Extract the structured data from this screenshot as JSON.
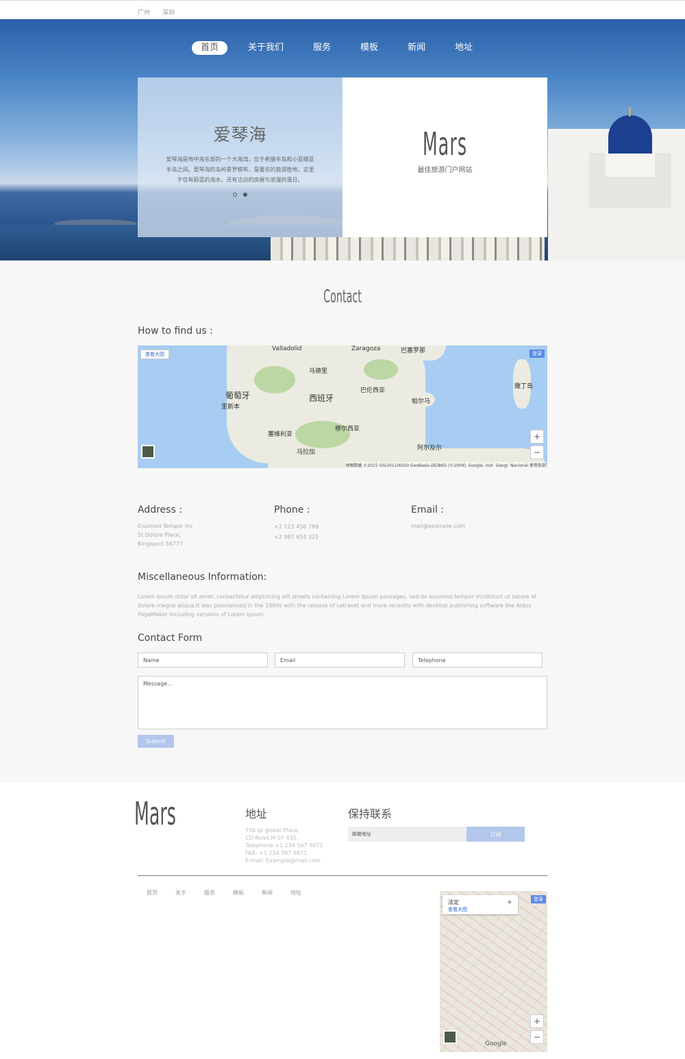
{
  "topbar": {
    "links": [
      "广州",
      "深圳"
    ]
  },
  "nav": {
    "items": [
      "首页",
      "关于我们",
      "服务",
      "模板",
      "新闻",
      "地址"
    ],
    "active": 0
  },
  "hero": {
    "title": "爱琴海",
    "description": "爱琴海是地中海东部的一个大海湾，位于希腊半岛和小亚细亚半岛之间。爱琴海的岛屿星罗棋布，是著名的旅游胜地，这里不仅有蔚蓝的海水，还有洁白的房屋与浪漫的落日。",
    "brand": "Mars",
    "brand_sub": "最佳旅游门户网站",
    "dots": 2,
    "active_dot": 1
  },
  "contact": {
    "section_title": "Contact",
    "find_label": "How to find us :",
    "map": {
      "big_map_btn": "查看大图",
      "badge": "登录",
      "zoom_in": "+",
      "zoom_out": "−",
      "attribution": "地图数据 ©2015 GS(2011)6020 GeoBasis-DE/BKG (©2009), Google, Inst. Geogr. Nacional   使用条款",
      "labels": [
        {
          "text": "Zaragoza",
          "cls": ""
        },
        {
          "text": "巴塞罗那",
          "cls": ""
        },
        {
          "text": "马德里",
          "cls": ""
        },
        {
          "text": "葡萄牙",
          "cls": "big"
        },
        {
          "text": "西班牙",
          "cls": "big"
        },
        {
          "text": "巴伦西亚",
          "cls": ""
        },
        {
          "text": "里斯本",
          "cls": ""
        },
        {
          "text": "塞维利亚",
          "cls": ""
        },
        {
          "text": "穆尔西亚",
          "cls": ""
        },
        {
          "text": "帕尔马",
          "cls": ""
        },
        {
          "text": "阿尔及尔",
          "cls": ""
        },
        {
          "text": "马拉加",
          "cls": ""
        },
        {
          "text": "撒丁岛",
          "cls": ""
        },
        {
          "text": "Valladolid",
          "cls": ""
        }
      ]
    },
    "address": {
      "title": "Address :",
      "lines": [
        "Eiusmod Tempor inc",
        "St Dolore Place,",
        "Kingsport 56777"
      ]
    },
    "phone": {
      "title": "Phone :",
      "lines": [
        "+2 123 456 789",
        "+2 987 654 321"
      ]
    },
    "email": {
      "title": "Email :",
      "lines": [
        "mail@example.com"
      ]
    },
    "misc_title": "Miscellaneous Information:",
    "misc_text": "Lorem ipsum dolor sit amet, consectetur adipisicing elit.sheets containing Lorem Ipsum passages, sed do eiusmod tempor incididunt ut labore et dolore magna aliqua.It was popularised in the 1960s with the release of Letraset and more recently with desktop publishing software like Aldus PageMaker including versions of Lorem Ipsum.",
    "form_title": "Contact Form",
    "form": {
      "name_placeholder": "Name",
      "email_placeholder": "Email",
      "telephone_placeholder": "Telephone",
      "message_placeholder": "Message...",
      "submit_label": "Submit"
    }
  },
  "footer": {
    "logo": "Mars",
    "address_title": "地址",
    "address_lines": [
      "756 gt globel Place,",
      "CD-Road,M 07 435.",
      "Telephone:+1 234 567 9871",
      "FAX: +1 234 567 9871",
      "E-mail: Example@mail.com"
    ],
    "keep_title": "保持联系",
    "subscribe_placeholder": "邮箱地址",
    "subscribe_label": "订阅",
    "nav": [
      "首页",
      "关于",
      "服务",
      "模板",
      "新闻",
      "地址"
    ],
    "map": {
      "place": "法定",
      "big_map_btn": "查看大图",
      "badge": "登录",
      "zoom_in": "+",
      "zoom_out": "−",
      "google": "Google"
    }
  },
  "colors": {
    "accent": "#b3c6ec",
    "map_water": "#a7cdf2",
    "badge": "#5a8ae8"
  }
}
